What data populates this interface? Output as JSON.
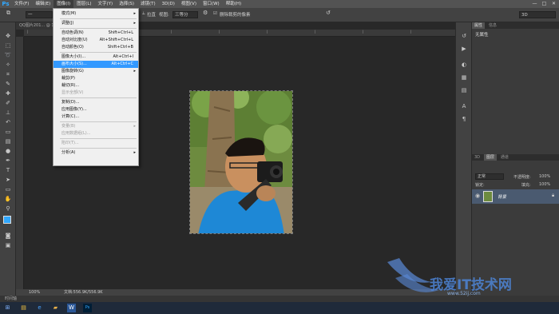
{
  "app": {
    "logo": "Ps"
  },
  "menubar": {
    "items": [
      "文件(F)",
      "编辑(E)",
      "图像(I)",
      "图层(L)",
      "文字(Y)",
      "选择(S)",
      "滤镜(T)",
      "3D(D)",
      "视图(V)",
      "窗口(W)",
      "帮助(H)"
    ],
    "active_index": 2,
    "window_controls": [
      "—",
      "□",
      "✕"
    ]
  },
  "options": {
    "preset": "一",
    "straighten_label": "拉直",
    "view_label": "视图:",
    "view_value": "三等分",
    "delete_cropped_label": "删除裁剪的像素",
    "workspace": "3D"
  },
  "document": {
    "tab_title": "QQ图片201... @ 17.3% (背景, RGB/8) *",
    "zoom": "100%",
    "status": "文档:556.9K/556.9K",
    "timeline_label": "时间轴"
  },
  "image_menu": {
    "items": [
      {
        "label": "模式(M)",
        "shortcut": "",
        "submenu": true,
        "disabled": false,
        "highlight": false
      },
      {
        "sep": true
      },
      {
        "label": "调整(J)",
        "shortcut": "",
        "submenu": true,
        "disabled": false,
        "highlight": false
      },
      {
        "sep": true
      },
      {
        "label": "自动色调(N)",
        "shortcut": "Shift+Ctrl+L",
        "submenu": false,
        "disabled": false,
        "highlight": false
      },
      {
        "label": "自动对比度(U)",
        "shortcut": "Alt+Shift+Ctrl+L",
        "submenu": false,
        "disabled": false,
        "highlight": false
      },
      {
        "label": "自动颜色(O)",
        "shortcut": "Shift+Ctrl+B",
        "submenu": false,
        "disabled": false,
        "highlight": false
      },
      {
        "sep": true
      },
      {
        "label": "图像大小(I)...",
        "shortcut": "Alt+Ctrl+I",
        "submenu": false,
        "disabled": false,
        "highlight": false
      },
      {
        "label": "画布大小(S)...",
        "shortcut": "Alt+Ctrl+C",
        "submenu": false,
        "disabled": false,
        "highlight": true
      },
      {
        "label": "图像旋转(G)",
        "shortcut": "",
        "submenu": true,
        "disabled": false,
        "highlight": false
      },
      {
        "label": "裁剪(P)",
        "shortcut": "",
        "submenu": false,
        "disabled": false,
        "highlight": false
      },
      {
        "label": "裁切(R)...",
        "shortcut": "",
        "submenu": false,
        "disabled": false,
        "highlight": false
      },
      {
        "label": "显示全部(V)",
        "shortcut": "",
        "submenu": false,
        "disabled": true,
        "highlight": false
      },
      {
        "sep": true
      },
      {
        "label": "复制(D)...",
        "shortcut": "",
        "submenu": false,
        "disabled": false,
        "highlight": false
      },
      {
        "label": "应用图像(Y)...",
        "shortcut": "",
        "submenu": false,
        "disabled": false,
        "highlight": false
      },
      {
        "label": "计算(C)...",
        "shortcut": "",
        "submenu": false,
        "disabled": false,
        "highlight": false
      },
      {
        "sep": true
      },
      {
        "label": "变量(B)",
        "shortcut": "",
        "submenu": true,
        "disabled": true,
        "highlight": false
      },
      {
        "label": "应用数据组(L)...",
        "shortcut": "",
        "submenu": false,
        "disabled": true,
        "highlight": false
      },
      {
        "sep": true
      },
      {
        "label": "陷印(T)...",
        "shortcut": "",
        "submenu": false,
        "disabled": true,
        "highlight": false
      },
      {
        "sep": true
      },
      {
        "label": "分析(A)",
        "shortcut": "",
        "submenu": true,
        "disabled": false,
        "highlight": false
      }
    ]
  },
  "properties_panel": {
    "tabs": [
      "属性",
      "信息"
    ],
    "content": "无属性"
  },
  "layers_panel": {
    "tabs": [
      "3D",
      "图层",
      "通道"
    ],
    "blend_mode": "正常",
    "opacity_label": "不透明度:",
    "opacity_value": "100%",
    "lock_label": "锁定:",
    "fill_label": "填充:",
    "fill_value": "100%",
    "layer_name": "背景"
  },
  "watermark": {
    "text": "我爱IT技术网",
    "url": "www.52ij.com"
  },
  "colors": {
    "accent": "#31a8ff",
    "menu_highlight": "#3399ff",
    "bg": "#282828"
  }
}
